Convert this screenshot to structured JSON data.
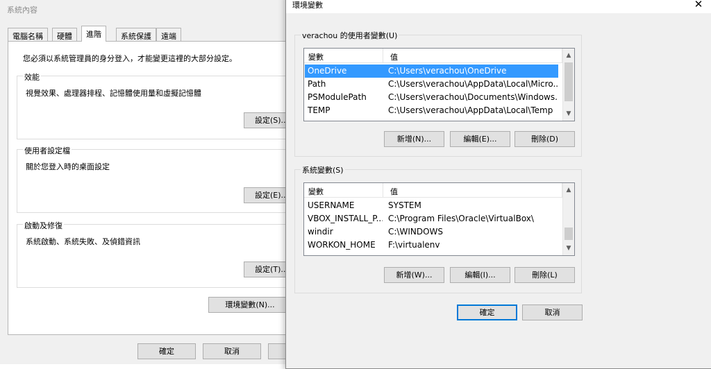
{
  "system_properties": {
    "title": "系統內容",
    "tabs": [
      "電腦名稱",
      "硬體",
      "進階",
      "系統保護",
      "遠端"
    ],
    "admin_note": "您必須以系統管理員的身分登入，才能變更這裡的大部分設定。",
    "performance": {
      "label": "效能",
      "desc": "視覺效果、處理器排程、記憶體使用量和虛擬記憶體",
      "button": "設定(S)..."
    },
    "user_profiles": {
      "label": "使用者設定檔",
      "desc": "關於您登入時的桌面設定",
      "button": "設定(E)..."
    },
    "startup_recovery": {
      "label": "啟動及修復",
      "desc": "系統啟動、系統失敗、及偵錯資訊",
      "button": "設定(T)..."
    },
    "env_button": "環境變數(N)...",
    "ok": "確定",
    "cancel": "取消"
  },
  "env_dialog": {
    "title": "環境變數",
    "close_glyph": "✕",
    "user_vars": {
      "label": "verachou 的使用者變數(U)",
      "col_var": "變數",
      "col_val": "值",
      "rows": [
        {
          "name": "OneDrive",
          "value": "C:\\Users\\verachou\\OneDrive",
          "selected": true
        },
        {
          "name": "Path",
          "value": "C:\\Users\\verachou\\AppData\\Local\\Micro..."
        },
        {
          "name": "PSModulePath",
          "value": "C:\\Users\\verachou\\Documents\\Windows..."
        },
        {
          "name": "TEMP",
          "value": "C:\\Users\\verachou\\AppData\\Local\\Temp"
        }
      ],
      "new": "新增(N)...",
      "edit": "編輯(E)...",
      "delete": "刪除(D)"
    },
    "system_vars": {
      "label": "系統變數(S)",
      "col_var": "變數",
      "col_val": "值",
      "rows": [
        {
          "name": "USERNAME",
          "value": "SYSTEM"
        },
        {
          "name": "VBOX_INSTALL_P...",
          "value": "C:\\Program Files\\Oracle\\VirtualBox\\"
        },
        {
          "name": "windir",
          "value": "C:\\WINDOWS"
        },
        {
          "name": "WORKON_HOME",
          "value": "F:\\virtualenv"
        }
      ],
      "new": "新增(W)...",
      "edit": "編輯(I)...",
      "delete": "刪除(L)"
    },
    "ok": "確定",
    "cancel": "取消"
  },
  "colors": {
    "selection": "#3399ff",
    "accent": "#0078d7",
    "dialog_bg": "#f0f0f0"
  }
}
